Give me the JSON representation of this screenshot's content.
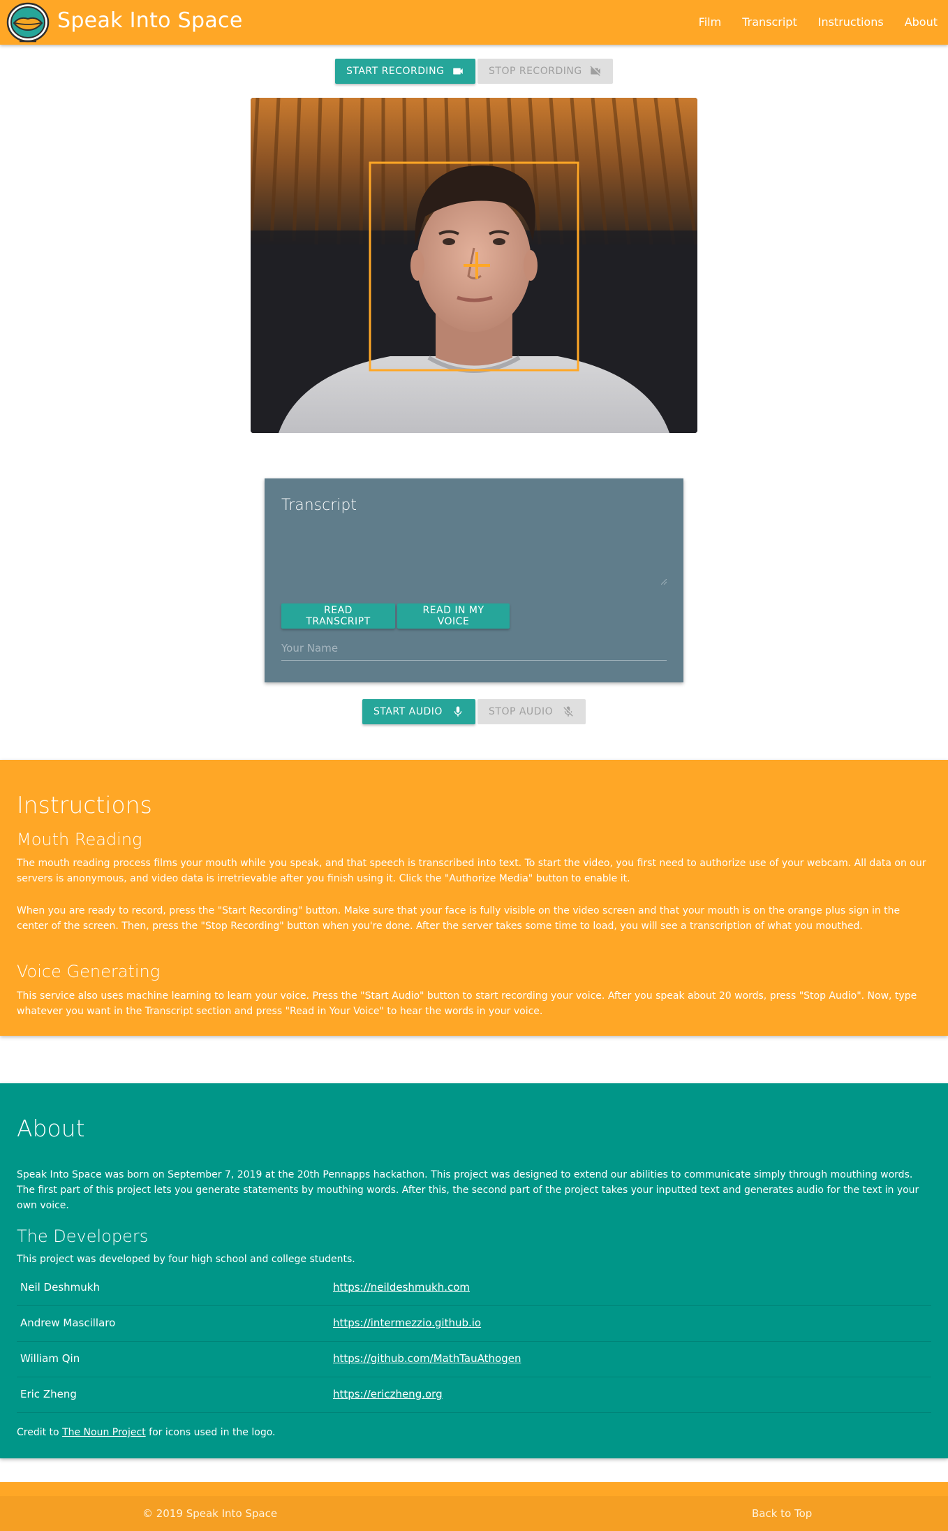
{
  "nav": {
    "brand": "Speak Into Space",
    "links": [
      "Film",
      "Transcript",
      "Instructions",
      "About"
    ]
  },
  "recording": {
    "start_label": "Start Recording",
    "stop_label": "Stop Recording",
    "start_icon": "videocam-icon",
    "stop_icon": "videocam-off-icon"
  },
  "transcript": {
    "title": "Transcript",
    "read_label": "Read Transcript",
    "read_voice_label": "Read in my voice",
    "name_placeholder": "Your Name",
    "name_value": ""
  },
  "audio": {
    "start_label": "Start Audio",
    "stop_label": "Stop Audio",
    "start_icon": "mic-icon",
    "stop_icon": "mic-off-icon"
  },
  "instructions": {
    "title": "Instructions",
    "mouth_title": "Mouth Reading",
    "mouth_p1": "The mouth reading process films your mouth while you speak, and that speech is transcribed into text. To start the video, you first need to authorize use of your webcam. All data on our servers is anonymous, and video data is irretrievable after you finish using it. Click the \"Authorize Media\" button to enable it.",
    "mouth_p2": "When you are ready to record, press the \"Start Recording\" button. Make sure that your face is fully visible on the video screen and that your mouth is on the orange plus sign in the center of the screen. Then, press the \"Stop Recording\" button when you're done. After the server takes some time to load, you will see a transcription of what you mouthed.",
    "voice_title": "Voice Generating",
    "voice_p": "This service also uses machine learning to learn your voice. Press the \"Start Audio\" button to start recording your voice. After you speak about 20 words, press \"Stop Audio\". Now, type whatever you want in the Transcript section and press \"Read in Your Voice\" to hear the words in your voice."
  },
  "about": {
    "title": "About",
    "p": "Speak Into Space was born on September 7, 2019 at the 20th Pennapps hackathon. This project was designed to extend our abilities to communicate simply through mouthing words. The first part of this project lets you generate statements by mouthing words. After this, the second part of the project takes your inputted text and generates audio for the text in your own voice.",
    "dev_title": "The Developers",
    "dev_intro": "This project was developed by four high school and college students.",
    "developers": [
      {
        "name": "Neil Deshmukh",
        "url": "https://neildeshmukh.com"
      },
      {
        "name": "Andrew Mascillaro",
        "url": "https://intermezzio.github.io"
      },
      {
        "name": "William Qin",
        "url": "https://github.com/MathTauAthogen"
      },
      {
        "name": "Eric Zheng",
        "url": "https://ericzheng.org"
      }
    ],
    "credit_prefix": "Credit to ",
    "credit_link": "The Noun Project",
    "credit_suffix": " for icons used in the logo."
  },
  "footer": {
    "copyright": "© 2019 Speak Into Space",
    "back_to_top": "Back to Top"
  },
  "colors": {
    "orange": "#ffa726",
    "teal": "#009688",
    "button_teal": "#26a69a",
    "card_grey": "#607d8b"
  }
}
